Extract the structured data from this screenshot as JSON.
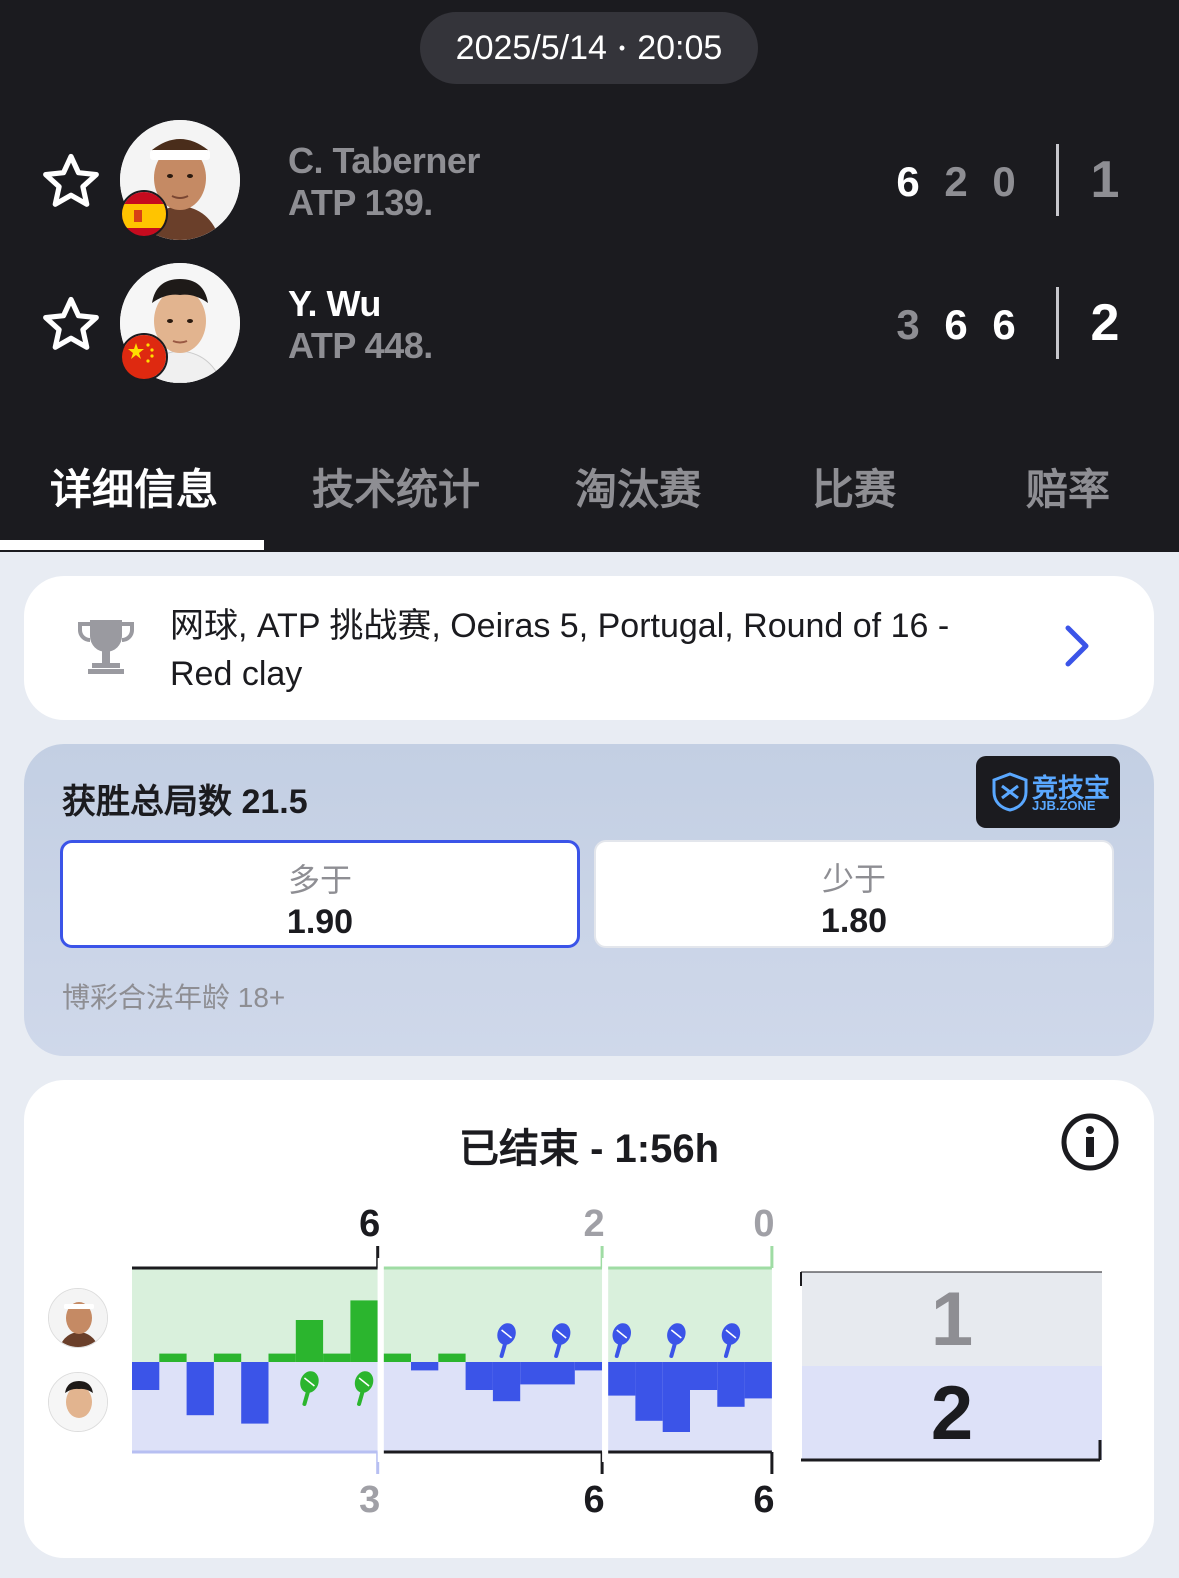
{
  "header": {
    "date": "2025/5/14",
    "dot": "•",
    "time": "20:05"
  },
  "players": [
    {
      "name": "C. Taberner",
      "rank": "ATP 139.",
      "flag": "spain-flag",
      "sets": [
        "6",
        "2",
        "0"
      ],
      "set_won": [
        true,
        false,
        false
      ],
      "total": "1"
    },
    {
      "name": "Y. Wu",
      "rank": "ATP 448.",
      "flag": "china-flag",
      "sets": [
        "3",
        "6",
        "6"
      ],
      "set_won": [
        false,
        true,
        true
      ],
      "total": "2"
    }
  ],
  "tabs": [
    "详细信息",
    "技术统计",
    "淘汰赛",
    "比赛",
    "赔率"
  ],
  "tournament": {
    "text": "网球, ATP 挑战赛, Oeiras 5, Portugal, Round of 16 - Red clay"
  },
  "odds": {
    "title": "获胜总局数 21.5",
    "brand_main": "竞技宝",
    "brand_sub": "JJB.ZONE",
    "over_label": "多于",
    "over_value": "1.90",
    "under_label": "少于",
    "under_value": "1.80",
    "legal": "博彩合法年龄 18+"
  },
  "match": {
    "status": "已结束 - 1:56h"
  },
  "colors": {
    "header_bg": "#1b1b1f",
    "accent_blue": "#3b54e8",
    "home_green": "#2bb52e",
    "away_blue": "#3b54e8",
    "home_area": "#d9f0dc",
    "away_area": "#dde1f8"
  },
  "chart_data": {
    "type": "bar",
    "sets": [
      {
        "top_label": "6",
        "bottom_label": "3",
        "winner": "top",
        "games": [
          -1,
          0.3,
          -1.9,
          0.3,
          -2.2,
          0.3,
          1.5,
          0.3,
          2.2
        ]
      },
      {
        "top_label": "2",
        "bottom_label": "6",
        "winner": "bottom",
        "games": [
          0.3,
          -0.3,
          0.3,
          -1,
          -1.4,
          -0.8,
          -0.8,
          -0.3
        ]
      },
      {
        "top_label": "0",
        "bottom_label": "6",
        "winner": "bottom",
        "games": [
          -1.2,
          -2.1,
          -2.5,
          -1,
          -1.6,
          -1.3
        ]
      }
    ],
    "break_markers": [
      {
        "side": "bottom",
        "set": 0,
        "game": 6
      },
      {
        "side": "bottom",
        "set": 0,
        "game": 8
      },
      {
        "side": "top",
        "set": 1,
        "game": 4
      },
      {
        "side": "top",
        "set": 1,
        "game": 6
      },
      {
        "side": "top",
        "set": 2,
        "game": 0
      },
      {
        "side": "top",
        "set": 2,
        "game": 2
      },
      {
        "side": "top",
        "set": 2,
        "game": 4
      }
    ],
    "totals": [
      "1",
      "2"
    ]
  }
}
